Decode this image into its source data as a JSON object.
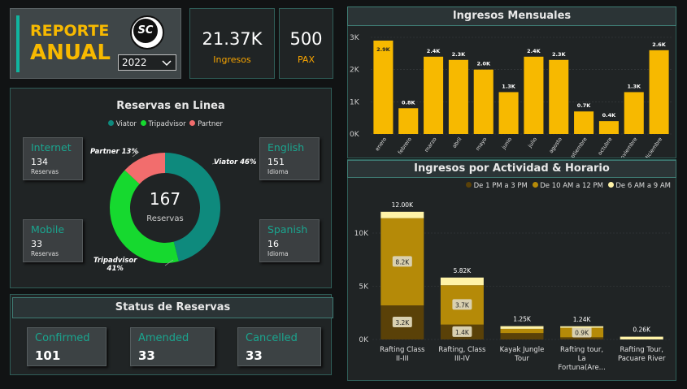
{
  "header": {
    "title_line1": "REPORTE",
    "title_line2": "ANUAL",
    "logo_text": "SC",
    "year_selected": "2022"
  },
  "kpis": {
    "ingresos_value": "21.37K",
    "ingresos_label": "Ingresos",
    "pax_value": "500",
    "pax_label": "PAX"
  },
  "reservas": {
    "title": "Reservas en Linea",
    "legend": [
      "Viator",
      "Tripadvisor",
      "Partner"
    ],
    "total_value": "167",
    "total_label": "Reservas",
    "cards": {
      "internet": {
        "label": "Internet",
        "value": "134",
        "sub": "Reservas"
      },
      "mobile": {
        "label": "Mobile",
        "value": "33",
        "sub": "Reservas"
      },
      "english": {
        "label": "English",
        "value": "151",
        "sub": "Idioma"
      },
      "spanish": {
        "label": "Spanish",
        "value": "16",
        "sub": "Idioma"
      }
    }
  },
  "status": {
    "title": "Status de Reservas",
    "confirmed_label": "Confirmed",
    "confirmed_value": "101",
    "amended_label": "Amended",
    "amended_value": "33",
    "cancelled_label": "Cancelled",
    "cancelled_value": "33"
  },
  "colors": {
    "teal": "#0e8a7d",
    "green": "#16d92f",
    "coral": "#f26d6d",
    "gold": "#f7b900",
    "dark_brown": "#5a4108",
    "olive": "#b58a08",
    "cream": "#fff3a8"
  },
  "chart_data": [
    {
      "type": "pie",
      "title": "Reservas en Linea",
      "labels": [
        "Viator",
        "Tripadvisor",
        "Partner"
      ],
      "values": [
        46,
        41,
        13
      ],
      "data_labels": [
        "Viator 46%",
        "Tripadvisor\n41%",
        "Partner 13%"
      ],
      "legend": "top",
      "center_text": "167"
    },
    {
      "type": "bar",
      "title": "Ingresos Mensuales",
      "categories": [
        "enero",
        "febrero",
        "marzo",
        "abril",
        "mayo",
        "junio",
        "julio",
        "agosto",
        "septiembre",
        "octubre",
        "noviembre",
        "diciembre"
      ],
      "values": [
        2.9,
        0.8,
        2.4,
        2.3,
        2.0,
        1.3,
        2.4,
        2.3,
        0.7,
        0.4,
        1.3,
        2.6
      ],
      "data_labels": [
        "2.9K",
        "0.8K",
        "2.4K",
        "2.3K",
        "2.0K",
        "1.3K",
        "2.4K",
        "2.3K",
        "0.7K",
        "0.4K",
        "1.3K",
        "2.6K"
      ],
      "ytick_labels": [
        "0K",
        "1K",
        "2K",
        "3K"
      ],
      "ylim": [
        0,
        3
      ],
      "grid": true
    },
    {
      "type": "bar",
      "stacked": true,
      "title": "Ingresos por Actividad & Horario",
      "categories": [
        "Rafting Class II-III",
        "Rafting, Class III-IV",
        "Kayak Jungle Tour",
        "Rafting tour, La Fortuna(Are...",
        "Rafting Tour, Pacuare River"
      ],
      "category_lines": [
        [
          "Rafting Class",
          "II-III"
        ],
        [
          "Rafting, Class",
          "III-IV"
        ],
        [
          "Kayak Jungle",
          "Tour"
        ],
        [
          "Rafting tour,",
          "La",
          "Fortuna(Are..."
        ],
        [
          "Rafting Tour,",
          "Pacuare River"
        ]
      ],
      "series": [
        {
          "name": "De 1 PM a 3 PM",
          "values": [
            3.2,
            1.4,
            0.6,
            0.2,
            0.0
          ],
          "labels": [
            "3.2K",
            "1.4K",
            "",
            "",
            ""
          ]
        },
        {
          "name": "De 10 AM a 12 PM",
          "values": [
            8.2,
            3.7,
            0.4,
            0.9,
            0.0
          ],
          "labels": [
            "8.2K",
            "3.7K",
            "",
            "0.9K",
            ""
          ]
        },
        {
          "name": "De 6 AM a 9 AM",
          "values": [
            0.6,
            0.72,
            0.25,
            0.14,
            0.26
          ],
          "labels": [
            "",
            "",
            "",
            "",
            ""
          ]
        }
      ],
      "totals": [
        "12.00K",
        "5.82K",
        "1.25K",
        "1.24K",
        "0.26K"
      ],
      "ytick_labels": [
        "0K",
        "5K",
        "10K"
      ],
      "ylim": [
        0,
        13
      ],
      "legend": "top-right"
    }
  ]
}
